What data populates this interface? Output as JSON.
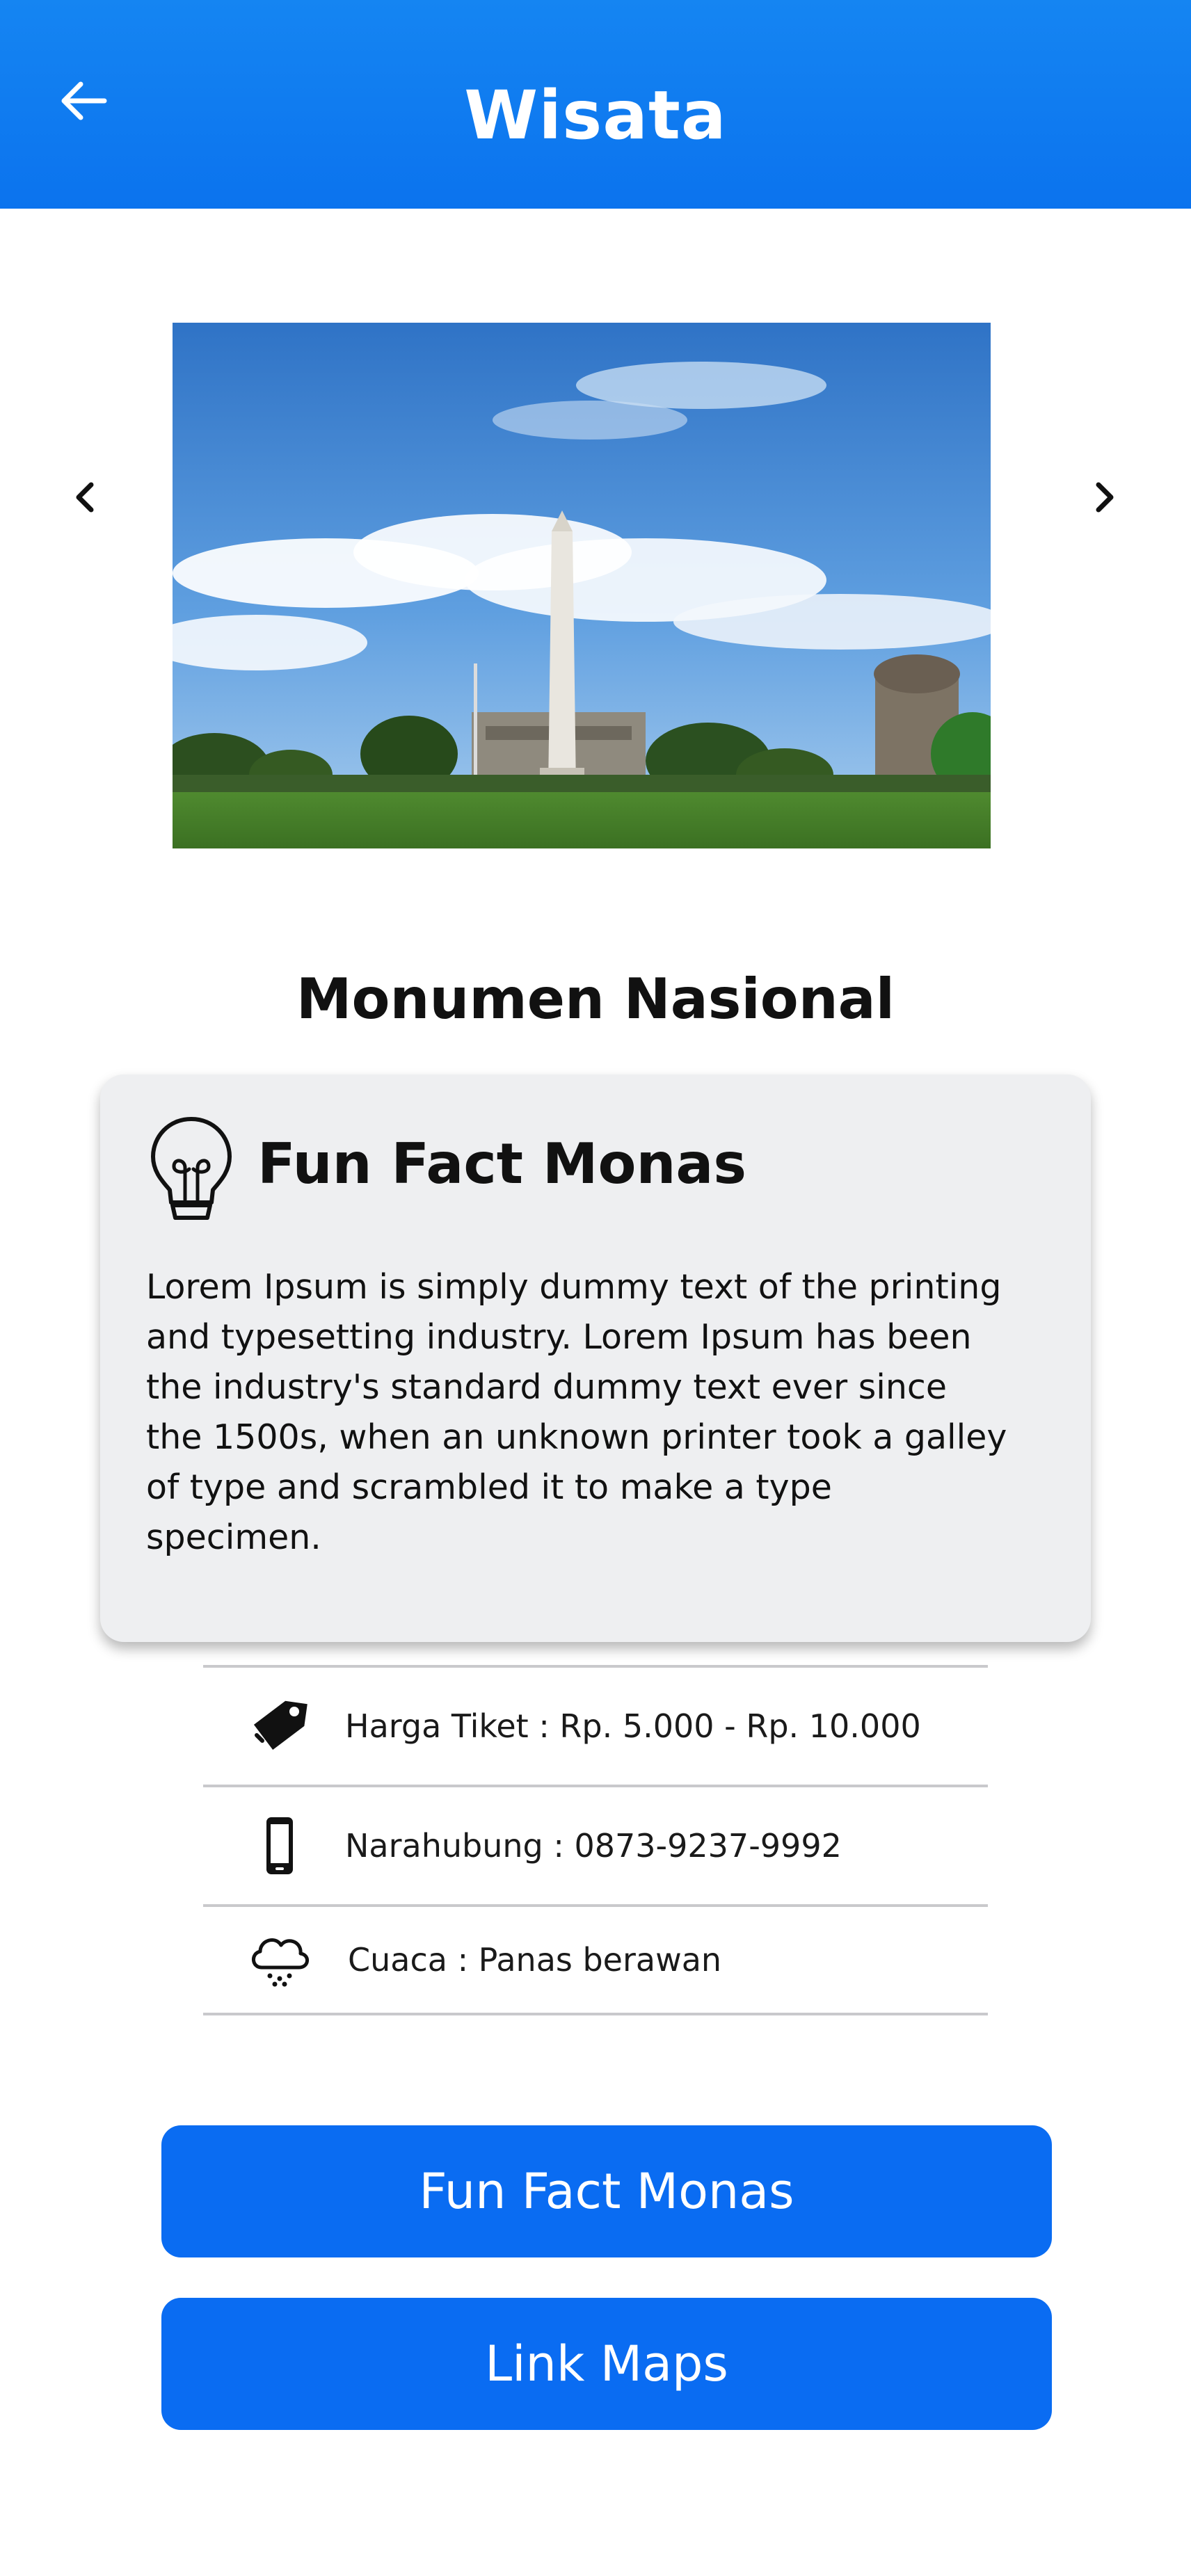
{
  "header": {
    "title": "Wisata",
    "back_icon": "arrow-left-icon",
    "background": "#0b73ee"
  },
  "carousel": {
    "prev_icon": "chevron-left-icon",
    "next_icon": "chevron-right-icon",
    "image_subject": "monument-photo"
  },
  "place": {
    "name": "Monumen Nasional"
  },
  "funfact_card": {
    "icon": "lightbulb-icon",
    "title": "Fun Fact Monas",
    "body": "Lorem Ipsum is simply dummy text of the printing and typesetting industry. Lorem Ipsum has been the industry's standard dummy text ever since the 1500s, when an unknown printer took a galley of type and scrambled it to make a type specimen."
  },
  "info": {
    "items": [
      {
        "icon": "price-tag-icon",
        "text": "Harga Tiket : Rp. 5.000 - Rp. 10.000"
      },
      {
        "icon": "smartphone-icon",
        "text": "Narahubung : 0873-9237-9992"
      },
      {
        "icon": "rain-cloud-icon",
        "text": "Cuaca : Panas berawan"
      }
    ]
  },
  "buttons": {
    "funfact_label": "Fun Fact Monas",
    "maps_label": "Link Maps",
    "color": "#0a6cf2"
  }
}
